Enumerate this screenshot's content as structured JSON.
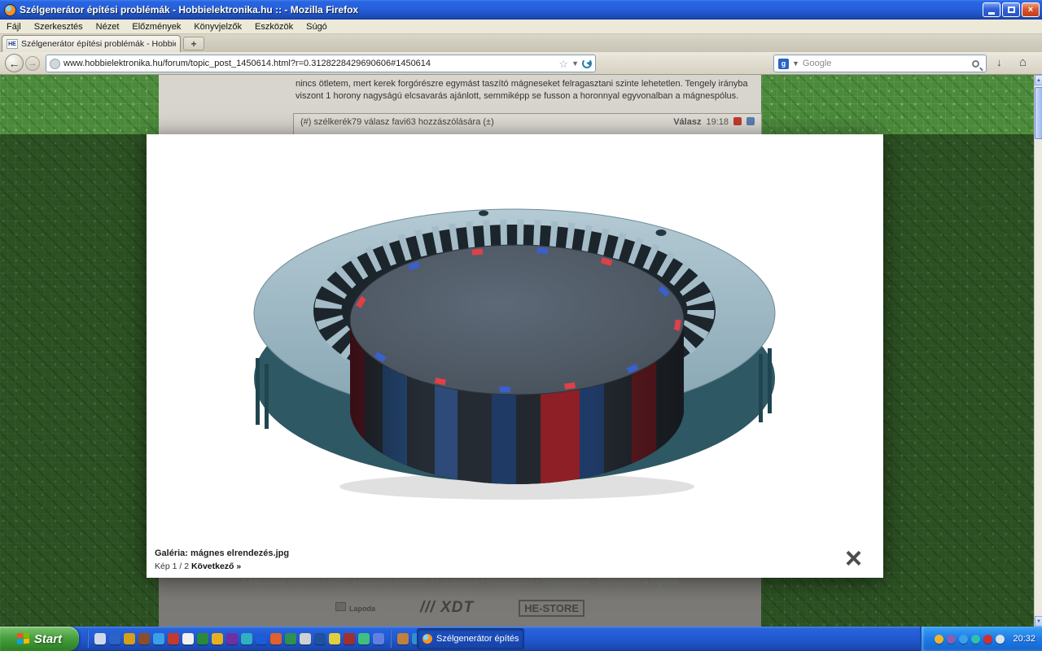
{
  "window": {
    "title": "Szélgenerátor építési problémák - Hobbielektronika.hu :: - Mozilla Firefox"
  },
  "menu": {
    "items": [
      "Fájl",
      "Szerkesztés",
      "Nézet",
      "Előzmények",
      "Könyvjelzők",
      "Eszközök",
      "Súgó"
    ]
  },
  "tabs": {
    "active_favicon": "HE",
    "active_title": "Szélgenerátor építési problémák - Hobbielekt...",
    "new_tab_label": "+"
  },
  "navigation": {
    "back_glyph": "←",
    "forward_glyph": "→",
    "url_value": "www.hobbielektronika.hu/forum/topic_post_1450614.html?r=0.3128228429690606#1450614",
    "star_glyph": "☆",
    "caret_glyph": "▼",
    "search_engine_initial": "g",
    "search_value": "Google",
    "download_glyph": "↓",
    "home_glyph": "⌂"
  },
  "page": {
    "post_text": "nincs ötletem, mert kerek forgórészre egymást taszító mágneseket felragasztani szinte lehetetlen. Tengely irányba viszont 1 horony nagyságú elcsavarás ajánlott, semmiképp se fusson a horonnyal egyvonalban a mágnespólus.",
    "reply_header_left": "(#) szélkerék79 válasz favi63 hozzászólására (±)",
    "reply_link": "Válasz",
    "reply_time": "19:18",
    "footer_links": "A használat feltételei • ÁSZF, használati útmutató és szabályok • Impresszum • Médiaajánlat • Bannereink & logóink",
    "logo_lapoda": "Lapoda",
    "logo_xdt": "/// XDT",
    "logo_store": "HE-STORE"
  },
  "lightbox": {
    "caption": "Galéria: mágnes elrendezés.jpg",
    "pager": "Kép 1 / 2",
    "next_label": "Következő »",
    "close_glyph": "×"
  },
  "scrollbar": {
    "up_glyph": "▲",
    "down_glyph": "▼"
  },
  "taskbar": {
    "start_label": "Start",
    "task_label": "Szélgenerátor építési ...",
    "clock": "20:32",
    "quicklaunch_icons": [
      {
        "name": "quicklaunch-icon-1",
        "color": "#cfd8e8"
      },
      {
        "name": "quicklaunch-icon-2",
        "color": "#2a62c8"
      },
      {
        "name": "quicklaunch-icon-3",
        "color": "#d4a017"
      },
      {
        "name": "quicklaunch-icon-4",
        "color": "#8a4f2a"
      },
      {
        "name": "quicklaunch-icon-5",
        "color": "#3aa0e8"
      },
      {
        "name": "quicklaunch-icon-6",
        "color": "#c23b2e"
      },
      {
        "name": "quicklaunch-icon-7",
        "color": "#f0f0f0"
      },
      {
        "name": "quicklaunch-icon-8",
        "color": "#2a8a3a"
      },
      {
        "name": "quicklaunch-icon-9",
        "color": "#e8b020"
      },
      {
        "name": "quicklaunch-icon-10",
        "color": "#7030a0"
      },
      {
        "name": "quicklaunch-icon-11",
        "color": "#30b0c0"
      },
      {
        "name": "quicklaunch-icon-12",
        "color": "#1e5bd8"
      },
      {
        "name": "quicklaunch-icon-13",
        "color": "#e06030"
      },
      {
        "name": "quicklaunch-icon-14",
        "color": "#309050"
      },
      {
        "name": "quicklaunch-icon-15",
        "color": "#d0d0d0"
      },
      {
        "name": "quicklaunch-icon-16",
        "color": "#2050a0"
      },
      {
        "name": "quicklaunch-icon-17",
        "color": "#e0d040"
      },
      {
        "name": "quicklaunch-icon-18",
        "color": "#a03030"
      },
      {
        "name": "quicklaunch-icon-19",
        "color": "#40c080"
      },
      {
        "name": "quicklaunch-icon-20",
        "color": "#6080e0"
      },
      {
        "name": "quicklaunch-icon-21",
        "color": "#c08040"
      },
      {
        "name": "quicklaunch-icon-22",
        "color": "#3090d0"
      },
      {
        "name": "quicklaunch-icon-23",
        "color": "#90c030"
      },
      {
        "name": "quicklaunch-icon-24",
        "color": "#d05020"
      }
    ],
    "tray_icons": [
      {
        "name": "tray-icon-1",
        "color": "#f2b428"
      },
      {
        "name": "tray-icon-2",
        "color": "#8a5fb0"
      },
      {
        "name": "tray-icon-3",
        "color": "#3aa0e8"
      },
      {
        "name": "tray-icon-4",
        "color": "#2fc0b0"
      },
      {
        "name": "tray-icon-5",
        "color": "#d03030"
      },
      {
        "name": "tray-icon-6",
        "color": "#d8e0e8"
      }
    ]
  },
  "colors": {
    "xp_blue": "#2157cf",
    "pcb_green": "#4a8a3a",
    "stator_steel": "#a4bcc7",
    "rotor_dark": "#272d35",
    "magnet_red": "#8e1f26",
    "magnet_blue": "#1f3a66"
  }
}
